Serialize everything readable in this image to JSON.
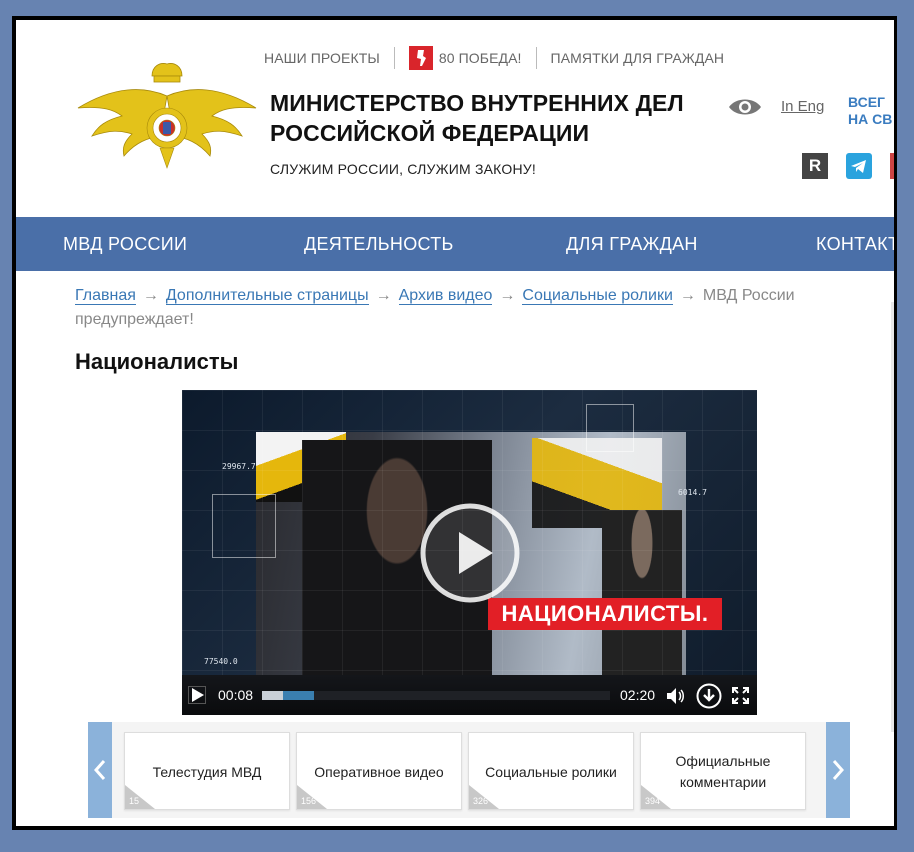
{
  "header": {
    "topnav": {
      "projects": "НАШИ ПРОЕКТЫ",
      "pobeda_badge": "80",
      "pobeda_text": "ПОБЕДА!",
      "memos": "ПАМЯТКИ ДЛЯ ГРАЖДАН"
    },
    "title_line1": "МИНИСТЕРСТВО ВНУТРЕННИХ ДЕЛ",
    "title_line2": "РОССИЙСКОЙ ФЕДЕРАЦИИ",
    "slogan": "СЛУЖИМ РОССИИ, СЛУЖИМ ЗАКОНУ!",
    "lang": "In Eng",
    "contact_line1": "ВСЕГ",
    "contact_line2": "НА СВ",
    "social_r": "R"
  },
  "mainnav": {
    "items": [
      "МВД РОССИИ",
      "ДЕЯТЕЛЬНОСТЬ",
      "ДЛЯ ГРАЖДАН",
      "КОНТАКТЫ"
    ]
  },
  "breadcrumb": {
    "items": [
      "Главная",
      "Дополнительные страницы",
      "Архив видео",
      "Социальные ролики"
    ],
    "separator": "→",
    "current": "МВД России предупреждает!"
  },
  "page_title": "Националисты",
  "video": {
    "overlay_title": "НАЦИОНАЛИСТЫ.",
    "overlay_numbers": [
      "29967.7",
      "6014.7",
      "77540.0"
    ],
    "current_time": "00:08",
    "duration": "02:20",
    "played_fraction": 0.06,
    "buffered_fraction": 0.15
  },
  "carousel": {
    "cards": [
      {
        "label": "Телестудия МВД",
        "count": "15"
      },
      {
        "label": "Оперативное видео",
        "count": "156"
      },
      {
        "label": "Социальные ролики",
        "count": "326"
      },
      {
        "label": "Официальные комментарии",
        "count": "394"
      }
    ]
  },
  "colors": {
    "nav_bg": "#4a6fa8",
    "link": "#3a78b5",
    "accent_red": "#e21f26",
    "carousel_arrow": "#8bb2da"
  }
}
